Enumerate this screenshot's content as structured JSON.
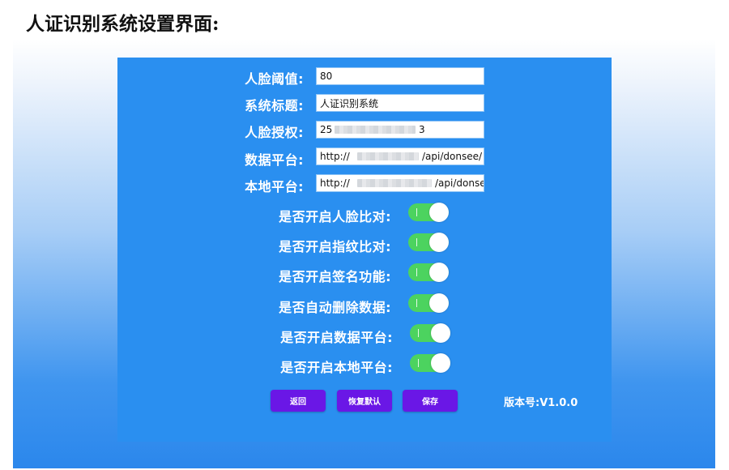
{
  "heading": "人证识别系统设置界面:",
  "fields": [
    {
      "label": "人脸阈值:",
      "value": "80"
    },
    {
      "label": "系统标题:",
      "value": "人证识别系统"
    },
    {
      "label": "人脸授权:",
      "value_prefix": "25",
      "value_suffix": "3"
    },
    {
      "label": "数据平台:",
      "value_prefix": "http://",
      "value_suffix": "/api/donsee/"
    },
    {
      "label": "本地平台:",
      "value_prefix": "http://",
      "value_suffix": "/api/donsee"
    }
  ],
  "toggles": [
    {
      "label": "是否开启人脸比对:",
      "on": true
    },
    {
      "label": "是否开启指纹比对:",
      "on": true
    },
    {
      "label": "是否开启签名功能:",
      "on": true
    },
    {
      "label": "是否自动删除数据:",
      "on": true
    },
    {
      "label": "是否开启数据平台:",
      "on": true
    },
    {
      "label": "是否开启本地平台:",
      "on": true
    }
  ],
  "buttons": {
    "back": "返回",
    "restore_default": "恢复默认",
    "save": "保存"
  },
  "version": "版本号:V1.0.0",
  "colors": {
    "panel": "#2a8ff0",
    "toggle_on": "#4cd35f",
    "button": "#6a17e6"
  }
}
